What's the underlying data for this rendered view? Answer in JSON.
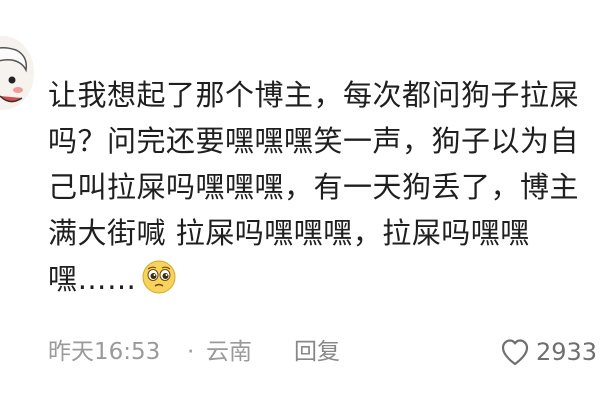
{
  "comment": {
    "lines": [
      "让我想起了那个博主，每次都问狗子拉屎",
      "吗？问完还要嘿嘿嘿笑一声，狗子以为自",
      "己叫拉屎吗嘿嘿嘿，有一天狗丢了，博主",
      "满大街喊 拉屎吗嘿嘿嘿，拉屎吗嘿嘿",
      "嘿……"
    ],
    "emoji_icon": "pleading-face-emoji"
  },
  "meta": {
    "time": "昨天16:53",
    "dot": "·",
    "location": "云南",
    "reply_label": "回复",
    "like_count": "2933"
  },
  "colors": {
    "text": "#1f1f1f",
    "meta": "#9a9a9a",
    "like": "#6f6f6f"
  }
}
